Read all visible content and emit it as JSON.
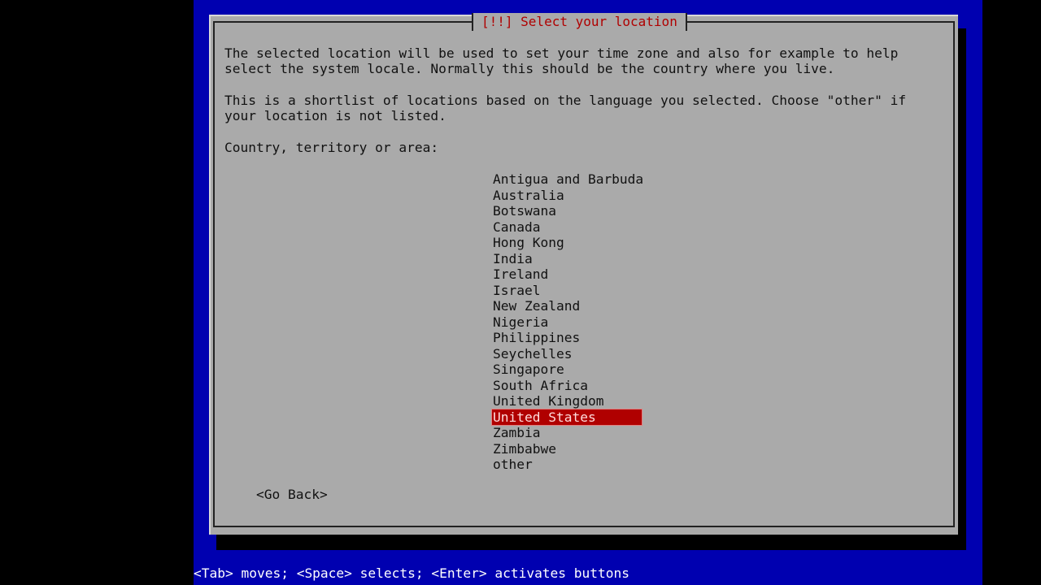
{
  "dialog": {
    "title": "[!!] Select your location",
    "paragraph1": [
      "The selected location will be used to set your time zone and also for example to help",
      "select the system locale. Normally this should be the country where you live."
    ],
    "paragraph2": [
      "This is a shortlist of locations based on the language you selected. Choose \"other\" if",
      "your location is not listed."
    ],
    "prompt": "Country, territory or area:",
    "options": [
      "Antigua and Barbuda",
      "Australia",
      "Botswana",
      "Canada",
      "Hong Kong",
      "India",
      "Ireland",
      "Israel",
      "New Zealand",
      "Nigeria",
      "Philippines",
      "Seychelles",
      "Singapore",
      "South Africa",
      "United Kingdom",
      "United States",
      "Zambia",
      "Zimbabwe",
      "other"
    ],
    "selected": "United States",
    "go_back_label": "<Go Back>"
  },
  "footer": {
    "hint": "<Tab> moves; <Space> selects; <Enter> activates buttons"
  },
  "colors": {
    "background": "#0000b0",
    "dialog": "#aaaaaa",
    "title": "#b00000",
    "selection": "#b00000"
  }
}
